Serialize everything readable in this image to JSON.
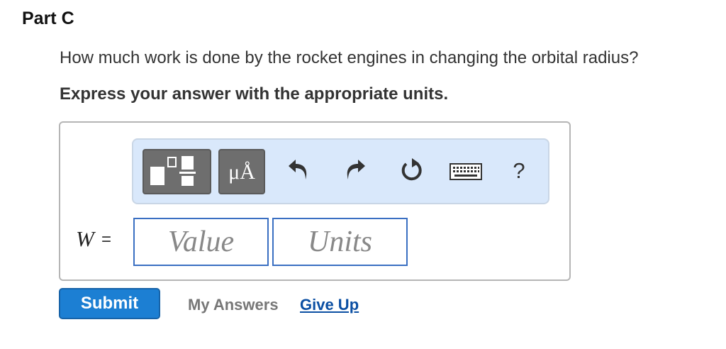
{
  "part": {
    "title": "Part C"
  },
  "question": {
    "text": "How much work is done by the rocket engines in changing the orbital radius?",
    "instruction": "Express your answer with the appropriate units."
  },
  "toolbar": {
    "templates_icon": "templates-icon",
    "units_label": "μÅ",
    "undo_icon": "undo-icon",
    "redo_icon": "redo-icon",
    "reset_icon": "reset-icon",
    "keyboard_icon": "keyboard-icon",
    "help_label": "?"
  },
  "answer": {
    "variable": "W",
    "equals": "=",
    "value_placeholder": "Value",
    "units_placeholder": "Units"
  },
  "actions": {
    "submit_label": "Submit",
    "my_answers_label": "My Answers",
    "give_up_label": "Give Up"
  },
  "colors": {
    "toolbar_bg": "#d9e8fb",
    "submit_bg": "#1c7fd3",
    "link": "#0b4fa3",
    "field_border": "#3a6fc2"
  }
}
